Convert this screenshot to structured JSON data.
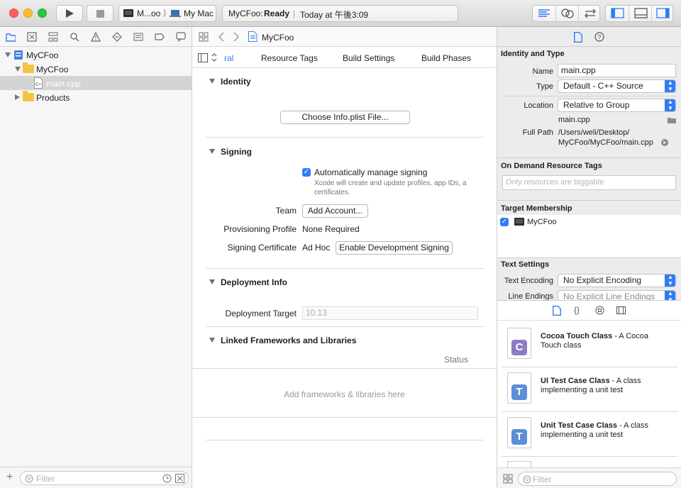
{
  "toolbar": {
    "scheme_target": "M...oo",
    "scheme_device": "My Mac",
    "activity_app": "MyCFoo:",
    "activity_state": "Ready",
    "activity_separator": "|",
    "activity_time": "Today at 午後3:09",
    "scheme_separator": "⟩"
  },
  "navigator": {
    "items": [
      {
        "label": "MyCFoo"
      },
      {
        "label": "MyCFoo"
      },
      {
        "label": "main.cpp"
      },
      {
        "label": "Products"
      }
    ],
    "filter_placeholder": "Filter",
    "add_label": "+"
  },
  "editor": {
    "breadcrumb": "MyCFoo",
    "tabs": [
      "ral",
      "Resource Tags",
      "Build Settings",
      "Build Phases"
    ],
    "identity": {
      "title": "Identity",
      "choose_button": "Choose Info.plist File..."
    },
    "signing": {
      "title": "Signing",
      "auto_label": "Automatically manage signing",
      "auto_desc_1": "Xcode will create and update profiles, app IDs, a",
      "auto_desc_2": "certificates.",
      "team_label": "Team",
      "team_button": "Add Account...",
      "profile_label": "Provisioning Profile",
      "profile_value": "None Required",
      "cert_label": "Signing Certificate",
      "cert_value": "Ad Hoc",
      "cert_button": "Enable Development Signing"
    },
    "deployment": {
      "title": "Deployment Info",
      "target_label": "Deployment Target",
      "target_value": "10.13"
    },
    "frameworks": {
      "title": "Linked Frameworks and Libraries",
      "status_header": "Status",
      "empty_text": "Add frameworks & libraries here"
    }
  },
  "inspector": {
    "identity_type": {
      "title": "Identity and Type",
      "name_label": "Name",
      "name_value": "main.cpp",
      "type_label": "Type",
      "type_value": "Default - C++ Source",
      "location_label": "Location",
      "location_value": "Relative to Group",
      "location_file": "main.cpp",
      "fullpath_label": "Full Path",
      "fullpath_line1": "/Users/weli/Desktop/",
      "fullpath_line2": "MyCFoo/MyCFoo/main.cpp"
    },
    "resource_tags": {
      "title": "On Demand Resource Tags",
      "placeholder": "Only resources are taggable"
    },
    "membership": {
      "title": "Target Membership",
      "target": "MyCFoo"
    },
    "text_settings": {
      "title": "Text Settings",
      "encoding_label": "Text Encoding",
      "encoding_value": "No Explicit Encoding",
      "endings_label": "Line Endings",
      "endings_value": "No Explicit Line Endings"
    },
    "library": {
      "items": [
        {
          "title": "Cocoa Touch Class",
          "desc_lead": " - A Cocoa",
          "desc_rest": "Touch class",
          "glyph": "C",
          "color": "#8e7cc3"
        },
        {
          "title": "UI Test Case Class",
          "desc_lead": " - A class",
          "desc_rest": "implementing a unit test",
          "glyph": "T",
          "color": "#5b8fd6"
        },
        {
          "title": "Unit Test Case Class",
          "desc_lead": " - A class",
          "desc_rest": "implementing a unit test",
          "glyph": "T",
          "color": "#5b8fd6"
        }
      ],
      "filter_placeholder": "Filter"
    }
  },
  "colors": {
    "accent": "#2f7df6",
    "selection": "#d4d4d4"
  }
}
